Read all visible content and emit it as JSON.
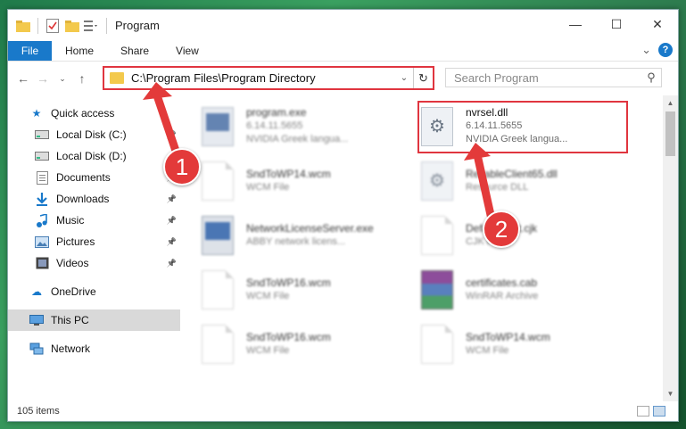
{
  "window": {
    "title": "Program",
    "controls": {
      "minimize": "—",
      "maximize": "☐",
      "close": "✕"
    }
  },
  "ribbon": {
    "tabs": [
      "File",
      "Home",
      "Share",
      "View"
    ],
    "expand": "⌄",
    "help": "?"
  },
  "address": {
    "path": "C:\\Program Files\\Program Directory",
    "search_placeholder": "Search Program"
  },
  "nav": {
    "quick_access": "Quick access",
    "items": [
      {
        "label": "Local Disk (C:)",
        "icon": "drive-icon",
        "pinned": true
      },
      {
        "label": "Local Disk (D:)",
        "icon": "drive-icon",
        "pinned": false
      },
      {
        "label": "Documents",
        "icon": "documents-icon",
        "pinned": true
      },
      {
        "label": "Downloads",
        "icon": "download-icon",
        "pinned": true
      },
      {
        "label": "Music",
        "icon": "music-icon",
        "pinned": true
      },
      {
        "label": "Pictures",
        "icon": "pictures-icon",
        "pinned": true
      },
      {
        "label": "Videos",
        "icon": "videos-icon",
        "pinned": true
      }
    ],
    "onedrive": "OneDrive",
    "this_pc": "This PC",
    "network": "Network"
  },
  "files": [
    {
      "name": "program.exe",
      "line2": "6.14.11.5655",
      "line3": "NVIDIA Greek langua...",
      "icon": "exe-icon",
      "blurred": true
    },
    {
      "name": "nvrsel.dll",
      "line2": "6.14.11.5655",
      "line3": "NVIDIA Greek langua...",
      "icon": "dll-icon",
      "blurred": false
    },
    {
      "name": "SndToWP14.wcm",
      "line2": "WCM File",
      "line3": "",
      "icon": "doc-icon",
      "blurred": true
    },
    {
      "name": "ReliableClient65.dll",
      "line2": "Resource DLL",
      "line3": "",
      "icon": "dll-icon",
      "blurred": true
    },
    {
      "name": "NetworkLicenseServer.exe",
      "line2": "ABBY network licens...",
      "line3": "",
      "icon": "net-icon",
      "blurred": true
    },
    {
      "name": "DefaultFont.cjk",
      "line2": "CJK File",
      "line3": "",
      "icon": "doc-icon",
      "blurred": true
    },
    {
      "name": "SndToWP16.wcm",
      "line2": "WCM File",
      "line3": "",
      "icon": "doc-icon",
      "blurred": true
    },
    {
      "name": "certificates.cab",
      "line2": "WinRAR Archive",
      "line3": "",
      "icon": "rar-icon",
      "blurred": true
    },
    {
      "name": "SndToWP16.wcm",
      "line2": "WCM File",
      "line3": "",
      "icon": "doc-icon",
      "blurred": true
    },
    {
      "name": "SndToWP14.wcm",
      "line2": "WCM File",
      "line3": "",
      "icon": "doc-icon",
      "blurred": true
    }
  ],
  "status": {
    "items": "105 items"
  },
  "callouts": {
    "one": "1",
    "two": "2"
  },
  "colors": {
    "accent": "#1979ca",
    "highlight": "#e0353f",
    "folder": "#f3c94c"
  }
}
